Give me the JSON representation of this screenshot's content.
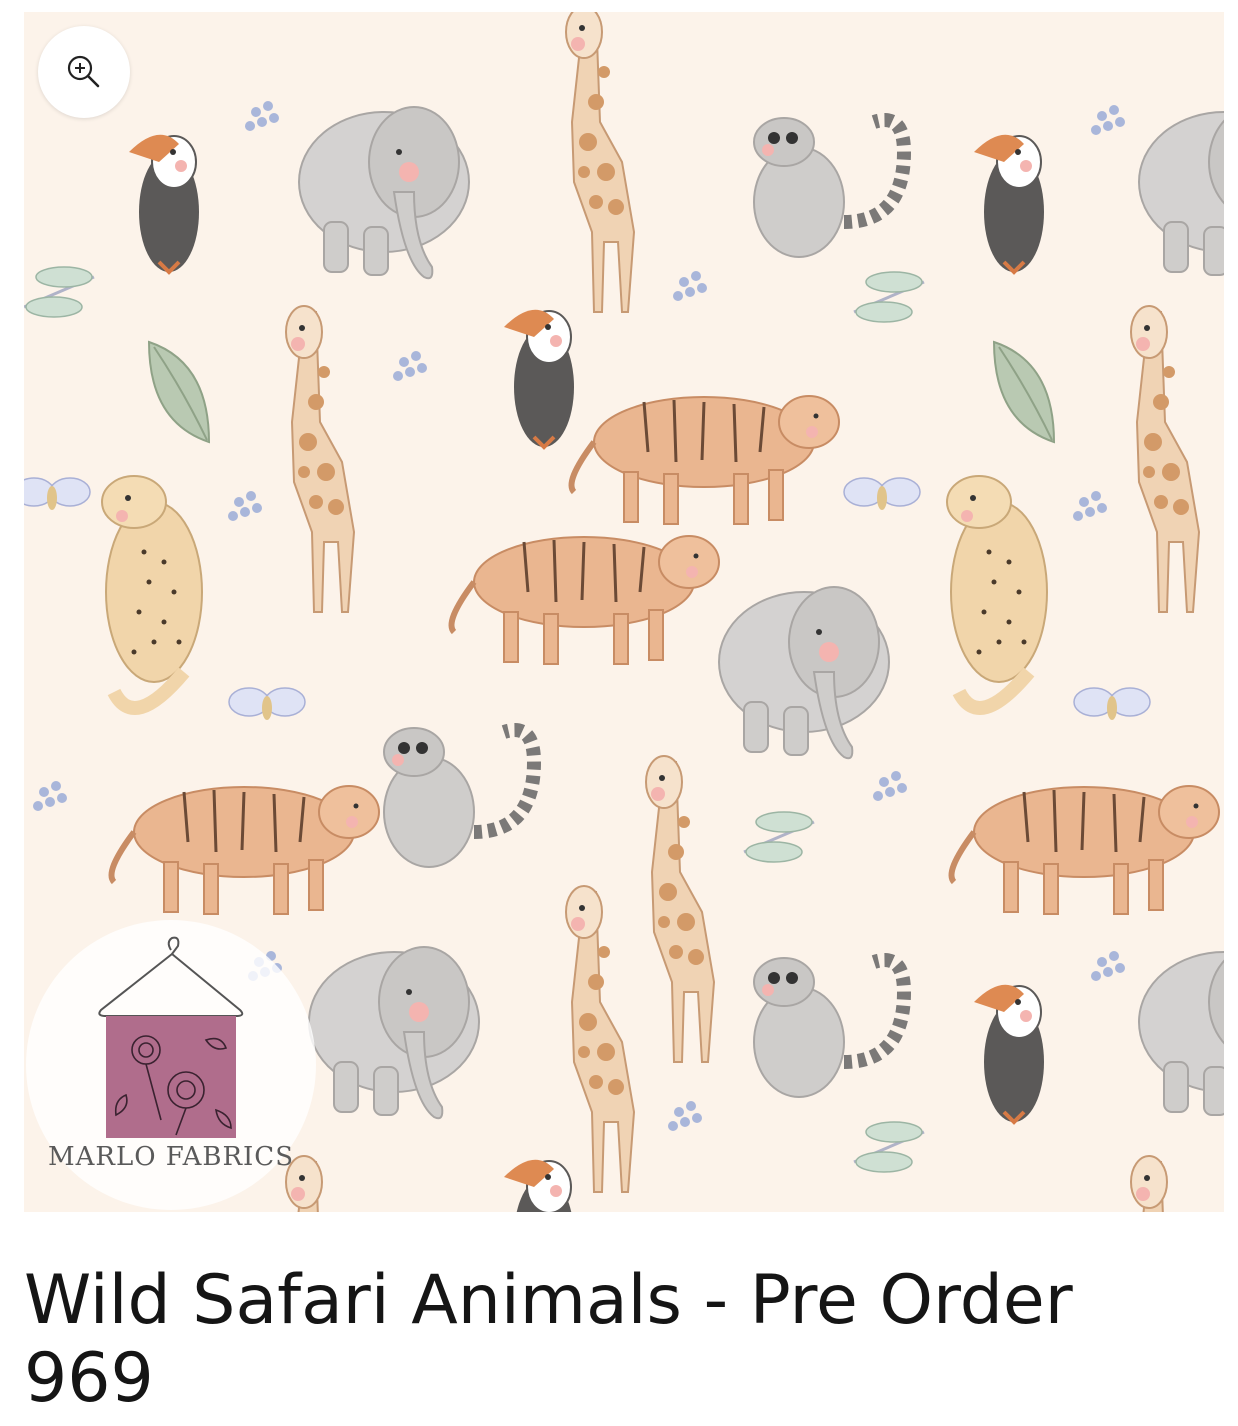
{
  "product": {
    "title": "Wild Safari Animals - Pre Order 969",
    "image_description": "safari-animals-fabric-pattern",
    "background_color": "#fcf3ea"
  },
  "zoom_button": {
    "icon": "zoom-in-icon"
  },
  "brand_logo": {
    "name": "MARLO FABRICS",
    "accent_color": "#b06d8c",
    "icon": "hanger-icon"
  }
}
